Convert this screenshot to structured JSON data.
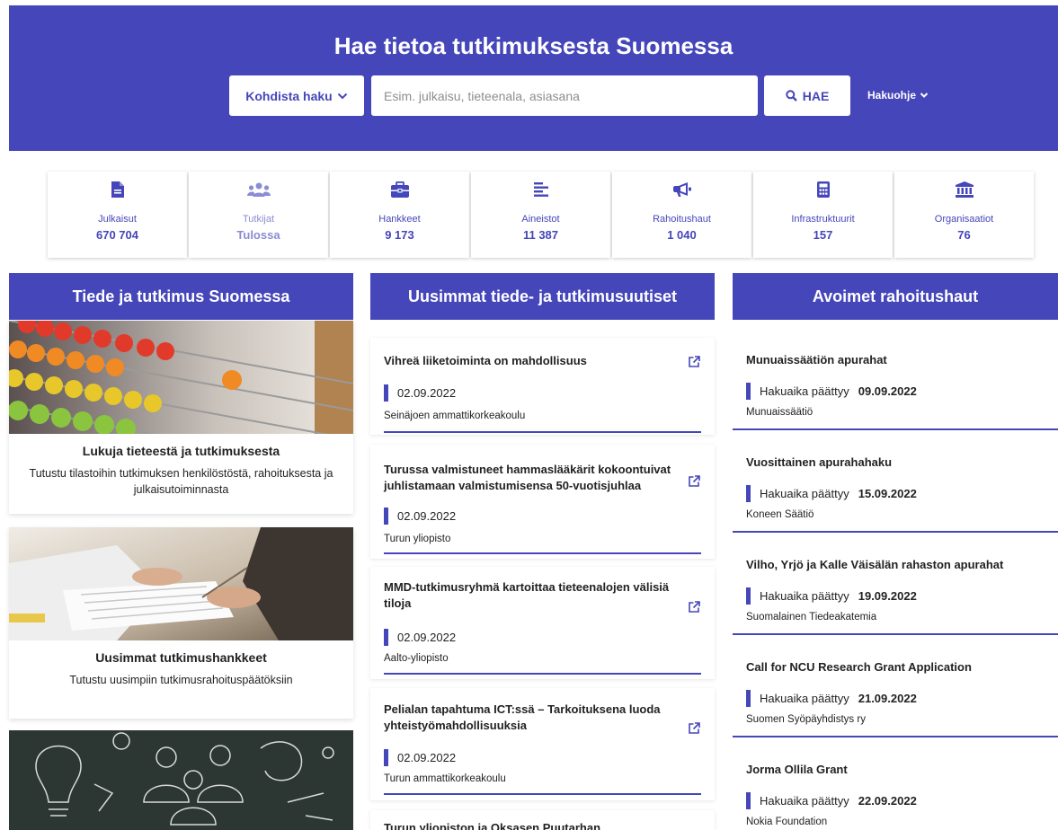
{
  "hero": {
    "title": "Hae tietoa tutkimuksesta Suomessa",
    "target_label": "Kohdista haku",
    "search_placeholder": "Esim. julkaisu, tieteenala, asiasana",
    "search_button": "HAE",
    "help_label": "Hakuohje"
  },
  "stats": [
    {
      "label": "Julkaisut",
      "value": "670 704",
      "icon": "file-icon"
    },
    {
      "label": "Tutkijat",
      "value": "Tulossa",
      "icon": "users-icon"
    },
    {
      "label": "Hankkeet",
      "value": "9 173",
      "icon": "briefcase-icon"
    },
    {
      "label": "Aineistot",
      "value": "11 387",
      "icon": "align-left-icon"
    },
    {
      "label": "Rahoitushaut",
      "value": "1 040",
      "icon": "megaphone-icon"
    },
    {
      "label": "Infrastruktuurit",
      "value": "157",
      "icon": "calculator-icon"
    },
    {
      "label": "Organisaatiot",
      "value": "76",
      "icon": "university-icon"
    }
  ],
  "columns": {
    "left": "Tiede ja tutkimus Suomessa",
    "middle": "Uusimmat tiede- ja tutkimusuutiset",
    "right": "Avoimet rahoitushaut"
  },
  "features": [
    {
      "title": "Lukuja tieteestä ja tutkimuksesta",
      "desc": "Tutustu tilastoihin tutkimuksen henkilöstöstä, rahoituksesta ja julkaisutoiminnasta"
    },
    {
      "title": "Uusimmat tutkimushankkeet",
      "desc": "Tutustu uusimpiin tutkimusrahoituspäätöksiin"
    },
    {
      "title": "",
      "desc": ""
    }
  ],
  "news": [
    {
      "title": "Vihreä liiketoiminta on mahdollisuus",
      "date": "02.09.2022",
      "source": "Seinäjoen ammattikorkeakoulu"
    },
    {
      "title": "Turussa valmistuneet hammaslääkärit kokoontuivat juhlistamaan valmistumisensa 50-vuotisjuhlaa",
      "date": "02.09.2022",
      "source": "Turun yliopisto"
    },
    {
      "title": "MMD-tutkimusryhmä kartoittaa tieteenalojen välisiä tiloja",
      "date": "02.09.2022",
      "source": "Aalto-yliopisto"
    },
    {
      "title": "Pelialan tapahtuma ICT:ssä – Tarkoituksena luoda yhteistyömahdollisuuksia",
      "date": "02.09.2022",
      "source": "Turun ammattikorkeakoulu"
    },
    {
      "title": "Turun yliopiston ja Oksasen Puutarhan",
      "date": "",
      "source": ""
    }
  ],
  "funding_deadline_label": "Hakuaika päättyy",
  "funding": [
    {
      "title": "Munuaissäätiön apurahat",
      "date": "09.09.2022",
      "org": "Munuaissäätiö"
    },
    {
      "title": "Vuosittainen apurahahaku",
      "date": "15.09.2022",
      "org": "Koneen Säätiö"
    },
    {
      "title": "Vilho, Yrjö ja Kalle Väisälän rahaston apurahat",
      "date": "19.09.2022",
      "org": "Suomalainen Tiedeakatemia"
    },
    {
      "title": "Call for NCU Research Grant Application",
      "date": "21.09.2022",
      "org": "Suomen Syöpäyhdistys ry"
    },
    {
      "title": "Jorma Ollila Grant",
      "date": "22.09.2022",
      "org": "Nokia Foundation"
    }
  ],
  "colors": {
    "brand": "#4546b9",
    "brand_light": "#8b8cd3"
  }
}
